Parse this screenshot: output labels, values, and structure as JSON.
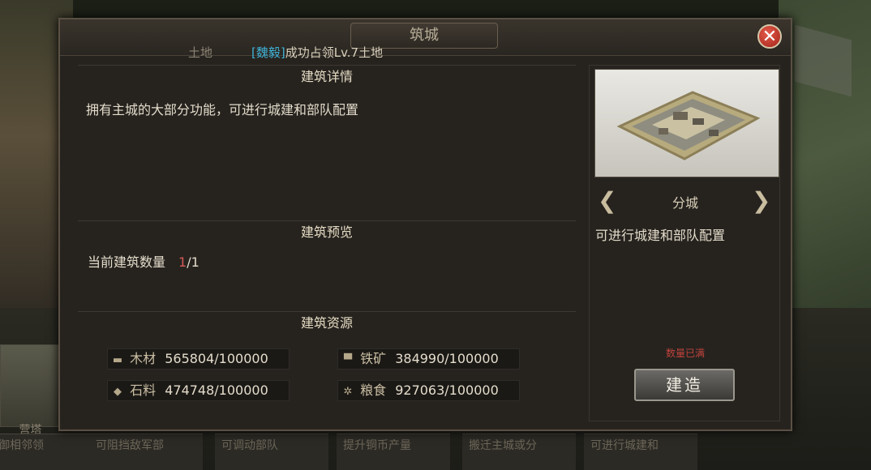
{
  "dialog": {
    "title": "筑城",
    "notice_prefix": "土地",
    "notice_name": "[魏毅]",
    "notice_text": "成功占领Lv.7土地"
  },
  "details": {
    "heading": "建筑详情",
    "description": "拥有主城的大部分功能，可进行城建和部队配置"
  },
  "preview_section": {
    "heading": "建筑预览",
    "count_label": "当前建筑数量",
    "count_current": "1",
    "count_max": "/1"
  },
  "resources": {
    "heading": "建筑资源",
    "items": [
      {
        "icon": "wood-icon",
        "name": "木材",
        "value": "565804/100000"
      },
      {
        "icon": "iron-icon",
        "name": "铁矿",
        "value": "384990/100000"
      },
      {
        "icon": "stone-icon",
        "name": "石料",
        "value": "474748/100000"
      },
      {
        "icon": "grain-icon",
        "name": "粮食",
        "value": "927063/100000"
      }
    ]
  },
  "building": {
    "type_name": "分城",
    "type_desc": "可进行城建和部队配置",
    "status": "数量已满",
    "build_label": "建造"
  },
  "background": {
    "left_label": "营塔",
    "bottom_cards": [
      "御相邻领",
      "可阻挡敌军部",
      "可调动部队",
      "提升铜币产量",
      "搬迁主城或分",
      "可进行城建和"
    ]
  }
}
